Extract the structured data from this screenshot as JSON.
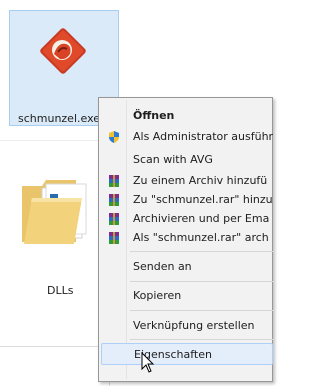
{
  "desktop": {
    "exe_item": {
      "label": "schmunzel.exe"
    },
    "folder_item": {
      "label": "DLLs"
    }
  },
  "context_menu": {
    "items": [
      {
        "label": "Öffnen",
        "icon": "none"
      },
      {
        "label": "Als Administrator ausführ",
        "icon": "uac-shield-icon"
      },
      {
        "label": "Scan with AVG",
        "icon": "none"
      },
      {
        "label": "Zu einem Archiv hinzufü",
        "icon": "winrar-icon"
      },
      {
        "label": "Zu \"schmunzel.rar\" hinzu",
        "icon": "winrar-icon"
      },
      {
        "label": "Archivieren und per Ema",
        "icon": "winrar-icon"
      },
      {
        "label": "Als \"schmunzel.rar\" arch",
        "icon": "winrar-icon"
      },
      {
        "label": "Senden an",
        "icon": "none"
      },
      {
        "label": "Kopieren",
        "icon": "none"
      },
      {
        "label": "Verknüpfung erstellen",
        "icon": "none"
      },
      {
        "label": "Eigenschaften",
        "icon": "none"
      }
    ]
  },
  "colors": {
    "selection": "#dbeaf8",
    "menu_bg": "#f2f2f2",
    "hover": "#e4eefb"
  }
}
